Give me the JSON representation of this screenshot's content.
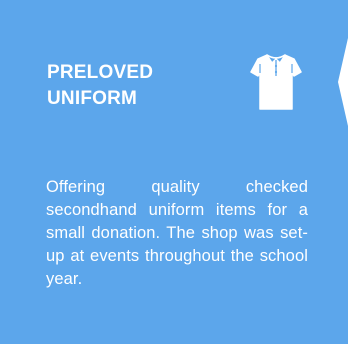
{
  "card": {
    "title_line1": "PRELOVED",
    "title_line2": "UNIFORM",
    "icon": "shirt-icon",
    "description": "Offering quality checked secondhand uniform items for a small donation. The shop was set-up at events throughout the school year."
  },
  "colors": {
    "card_background": "#5ca6eb",
    "text": "#ffffff"
  }
}
